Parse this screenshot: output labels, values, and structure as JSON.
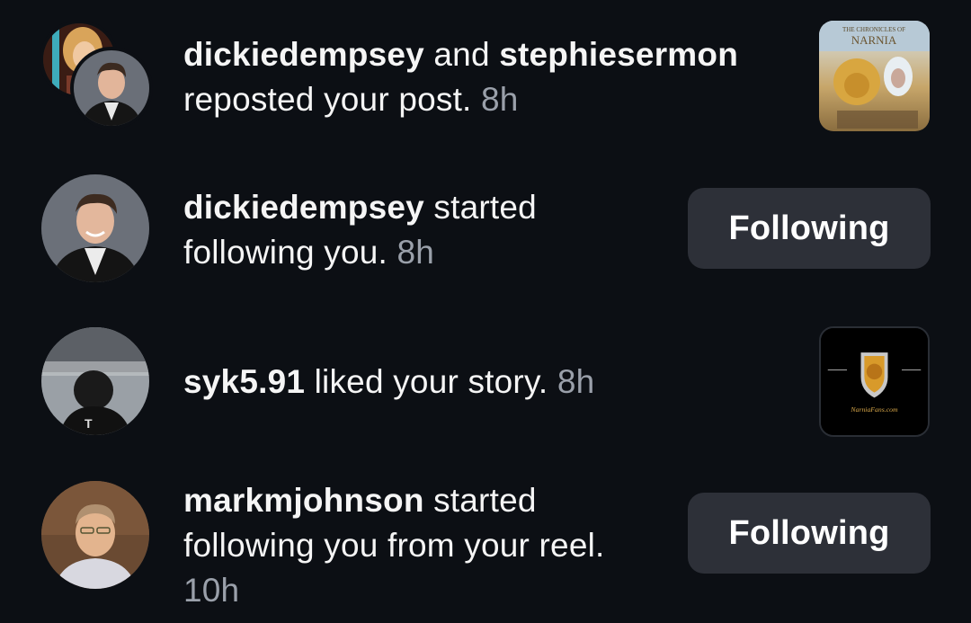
{
  "notifications": [
    {
      "user1": "dickiedempsey",
      "connector": " and ",
      "user2": "stephiesermon",
      "action": "reposted your post.",
      "time": "8h",
      "thumb_text": "NARNIA"
    },
    {
      "user": "dickiedempsey",
      "action_line1": " started",
      "action_line2": "following you.",
      "time": "8h",
      "button_label": "Following"
    },
    {
      "user": "syk5.91",
      "action": " liked your story.",
      "time": "8h",
      "thumb_text": "NarniaFans.com"
    },
    {
      "user": "markmjohnson",
      "action_line1": " started",
      "action_line2": "following you from your reel.",
      "time": "10h",
      "button_label": "Following"
    }
  ],
  "colors": {
    "background": "#0c0f14",
    "button": "#2d3038",
    "muted_text": "#9aa0aa"
  }
}
